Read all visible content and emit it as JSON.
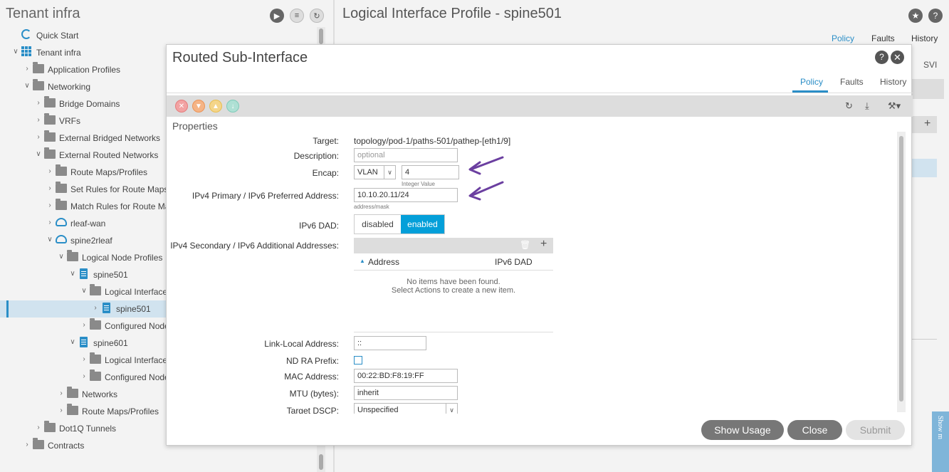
{
  "left": {
    "title": "Tenant infra",
    "tree": [
      {
        "label": "Quick Start",
        "icon": "quick-start-icon",
        "indent": 0,
        "chev": ""
      },
      {
        "label": "Tenant infra",
        "icon": "tenant-icon",
        "indent": 0,
        "chev": "down"
      },
      {
        "label": "Application Profiles",
        "icon": "folder-icon",
        "indent": 1,
        "chev": "right"
      },
      {
        "label": "Networking",
        "icon": "folder-icon",
        "indent": 1,
        "chev": "down"
      },
      {
        "label": "Bridge Domains",
        "icon": "folder-icon",
        "indent": 2,
        "chev": "right"
      },
      {
        "label": "VRFs",
        "icon": "folder-icon",
        "indent": 2,
        "chev": "right"
      },
      {
        "label": "External Bridged Networks",
        "icon": "folder-icon",
        "indent": 2,
        "chev": "right"
      },
      {
        "label": "External Routed Networks",
        "icon": "folder-icon",
        "indent": 2,
        "chev": "down"
      },
      {
        "label": "Route Maps/Profiles",
        "icon": "folder-icon",
        "indent": 3,
        "chev": "right"
      },
      {
        "label": "Set Rules for Route Maps",
        "icon": "folder-icon",
        "indent": 3,
        "chev": "right"
      },
      {
        "label": "Match Rules for Route Map",
        "icon": "folder-icon",
        "indent": 3,
        "chev": "right"
      },
      {
        "label": "rleaf-wan",
        "icon": "cloud-icon",
        "indent": 3,
        "chev": "right"
      },
      {
        "label": "spine2rleaf",
        "icon": "cloud-icon",
        "indent": 3,
        "chev": "down"
      },
      {
        "label": "Logical Node Profiles",
        "icon": "folder-icon",
        "indent": 4,
        "chev": "down"
      },
      {
        "label": "spine501",
        "icon": "doc-icon",
        "indent": 5,
        "chev": "down"
      },
      {
        "label": "Logical Interface I",
        "icon": "folder-icon",
        "indent": 6,
        "chev": "down"
      },
      {
        "label": "spine501",
        "icon": "doc-icon",
        "indent": 7,
        "chev": "right",
        "selected": true
      },
      {
        "label": "Configured Node:",
        "icon": "folder-icon",
        "indent": 6,
        "chev": "right"
      },
      {
        "label": "spine601",
        "icon": "doc-icon",
        "indent": 5,
        "chev": "down"
      },
      {
        "label": "Logical Interface I",
        "icon": "folder-icon",
        "indent": 6,
        "chev": "right"
      },
      {
        "label": "Configured Node:",
        "icon": "folder-icon",
        "indent": 6,
        "chev": "right"
      },
      {
        "label": "Networks",
        "icon": "folder-icon",
        "indent": 4,
        "chev": "right"
      },
      {
        "label": "Route Maps/Profiles",
        "icon": "folder-icon",
        "indent": 4,
        "chev": "right"
      },
      {
        "label": "Dot1Q Tunnels",
        "icon": "folder-icon",
        "indent": 2,
        "chev": "right"
      },
      {
        "label": "Contracts",
        "icon": "folder-icon",
        "indent": 1,
        "chev": "right"
      }
    ]
  },
  "right": {
    "title": "Logical Interface Profile - spine501",
    "tabs": [
      "Policy",
      "Faults",
      "History"
    ],
    "svi_label": "SVI",
    "show_me": "Show m"
  },
  "modal": {
    "title": "Routed Sub-Interface",
    "tabs": [
      "Policy",
      "Faults",
      "History"
    ],
    "properties_title": "Properties",
    "target_label": "Target:",
    "target_value": "topology/pod-1/paths-501/pathep-[eth1/9]",
    "description_label": "Description:",
    "description_placeholder": "optional",
    "encap_label": "Encap:",
    "encap_type": "VLAN",
    "encap_value": "4",
    "encap_hint": "Integer Value",
    "ipv4_label": "IPv4 Primary / IPv6 Preferred Address:",
    "ipv4_value": "10.10.20.11/24",
    "ipv4_hint": "address/mask",
    "dad_label": "IPv6 DAD:",
    "dad_off": "disabled",
    "dad_on": "enabled",
    "secondary_label": "IPv4 Secondary / IPv6 Additional Addresses:",
    "col_address": "Address",
    "col_dad": "IPv6 DAD",
    "empty_line1": "No items have been found.",
    "empty_line2": "Select Actions to create a new item.",
    "linklocal_label": "Link-Local Address:",
    "linklocal_value": "::",
    "ndra_label": "ND RA Prefix:",
    "mac_label": "MAC Address:",
    "mac_value": "00:22:BD:F8:19:FF",
    "mtu_label": "MTU (bytes):",
    "mtu_value": "inherit",
    "dscp_label": "Target DSCP:",
    "dscp_value": "Unspecified",
    "btn_usage": "Show Usage",
    "btn_close": "Close",
    "btn_submit": "Submit"
  },
  "colors": {
    "accent": "#2a8ec7",
    "toggle_on": "#049fd9",
    "arrow": "#6b3fa0"
  }
}
